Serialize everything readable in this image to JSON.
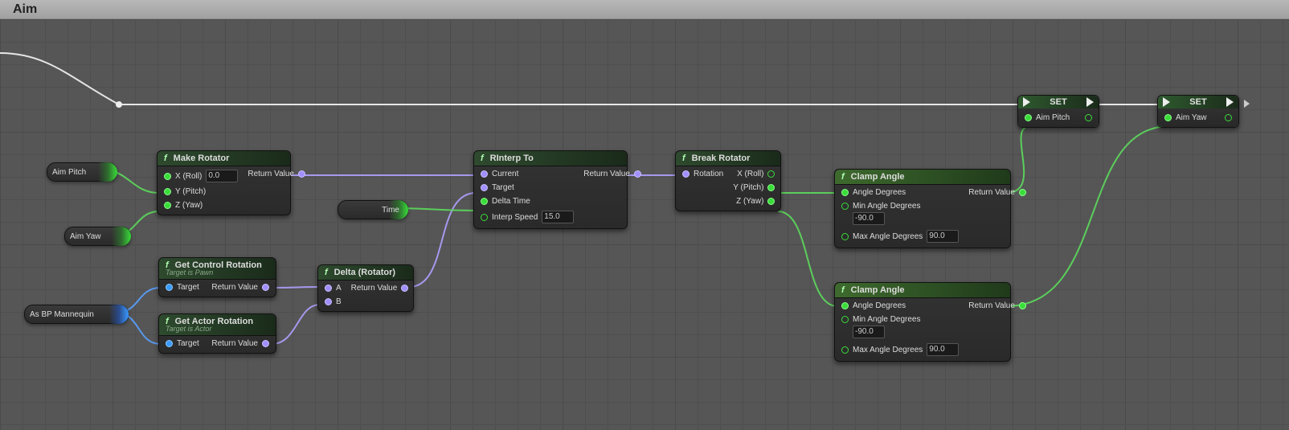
{
  "section_title": "Aim",
  "pills": {
    "aim_pitch": "Aim Pitch",
    "aim_yaw": "Aim Yaw",
    "as_bp_mannequin": "As BP Mannequin",
    "time": "Time"
  },
  "nodes": {
    "make_rotator": {
      "title": "Make Rotator",
      "pins": {
        "x": "X (Roll)",
        "x_val": "0.0",
        "y": "Y (Pitch)",
        "z": "Z (Yaw)",
        "ret": "Return Value"
      }
    },
    "get_control_rotation": {
      "title": "Get Control Rotation",
      "sub": "Target is Pawn",
      "pins": {
        "target": "Target",
        "ret": "Return Value"
      }
    },
    "get_actor_rotation": {
      "title": "Get Actor Rotation",
      "sub": "Target is Actor",
      "pins": {
        "target": "Target",
        "ret": "Return Value"
      }
    },
    "delta": {
      "title": "Delta (Rotator)",
      "pins": {
        "a": "A",
        "b": "B",
        "ret": "Return Value"
      }
    },
    "rinterp": {
      "title": "RInterp To",
      "pins": {
        "current": "Current",
        "target": "Target",
        "delta_time": "Delta Time",
        "interp_speed": "Interp Speed",
        "interp_val": "15.0",
        "ret": "Return Value"
      }
    },
    "break_rotator": {
      "title": "Break Rotator",
      "pins": {
        "rot": "Rotation",
        "x": "X (Roll)",
        "y": "Y (Pitch)",
        "z": "Z (Yaw)"
      }
    },
    "clamp1": {
      "title": "Clamp Angle",
      "pins": {
        "angle": "Angle Degrees",
        "min": "Min Angle Degrees",
        "min_val": "-90.0",
        "max": "Max Angle Degrees",
        "max_val": "90.0",
        "ret": "Return Value"
      }
    },
    "clamp2": {
      "title": "Clamp Angle",
      "pins": {
        "angle": "Angle Degrees",
        "min": "Min Angle Degrees",
        "min_val": "-90.0",
        "max": "Max Angle Degrees",
        "max_val": "90.0",
        "ret": "Return Value"
      }
    }
  },
  "set_nodes": {
    "set1": {
      "label": "SET",
      "var": "Aim Pitch"
    },
    "set2": {
      "label": "SET",
      "var": "Aim Yaw"
    }
  }
}
